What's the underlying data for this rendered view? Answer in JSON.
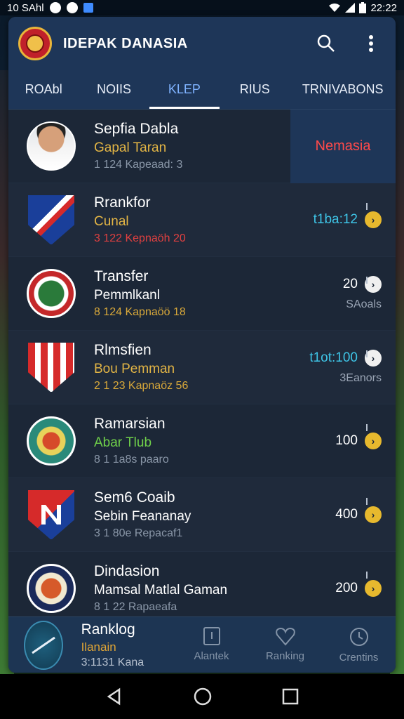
{
  "status_bar": {
    "left_text": "10 SAhl",
    "time": "22:22"
  },
  "header": {
    "title": "IDEPAK DANASIA",
    "search_icon": "search-icon",
    "menu_icon": "more-vert-icon"
  },
  "tabs": [
    {
      "label": "ROAbl"
    },
    {
      "label": "NOIIS"
    },
    {
      "label": "KLEP"
    },
    {
      "label": "RIUS"
    },
    {
      "label": "TRNIVABONS"
    }
  ],
  "rows": [
    {
      "title": "Sepfia Dabla",
      "sub": "Gapal Taran",
      "sub_color": "#e3b545",
      "meta": "1 124 Kapeaad: 3",
      "meta_color": "#8a97a8",
      "badge": "Nemasia"
    },
    {
      "title": "Rrankfor",
      "sub": "Cunal",
      "sub_color": "#e3b545",
      "meta": "3 122 Kepnaöh 20",
      "meta_color": "#e04040",
      "value": "t1ba:12",
      "value_color": "#3ec4e6",
      "right_sub": ""
    },
    {
      "title": "Transfer",
      "sub": "Pemmlkanl",
      "sub_color": "#ffffff",
      "meta": "8 124 Kapnaöö 18",
      "meta_color": "#d8a83a",
      "value": "20",
      "value_color": "#ffffff",
      "right_sub": "SAoals"
    },
    {
      "title": "Rlmsfien",
      "sub": "Bou Pemman",
      "sub_color": "#e3b545",
      "meta": "2 1 23 Kapnaöz 56",
      "meta_color": "#d8a83a",
      "value": "t1ot:100",
      "value_color": "#3ec4e6",
      "right_sub": "3Eanors"
    },
    {
      "title": "Ramarsian",
      "sub": "Abar Tlub",
      "sub_color": "#6fcf4a",
      "meta": "8 1 1a8s paaro",
      "meta_color": "#8a97a8",
      "value": "100",
      "value_color": "#ffffff",
      "right_sub": ""
    },
    {
      "title": "Sem6 Coaib",
      "sub": "Sebin Feananay",
      "sub_color": "#ffffff",
      "meta": "3 1 80e Repacaf1",
      "meta_color": "#8a97a8",
      "value": "400",
      "value_color": "#ffffff",
      "right_sub": ""
    },
    {
      "title": "Dindasion",
      "sub": "Mamsal Matlal Gaman",
      "sub_color": "#ffffff",
      "meta": "8 1 22 Rapaeafa",
      "meta_color": "#8a97a8",
      "value": "200",
      "value_color": "#ffffff",
      "right_sub": ""
    }
  ],
  "bottom_bar": {
    "title": "Ranklog",
    "sub": "Ilanain",
    "meta": "3:1131 Kana",
    "nav": [
      {
        "label": "Alantek",
        "icon": "card-icon"
      },
      {
        "label": "Ranking",
        "icon": "heart-icon"
      },
      {
        "label": "Crentins",
        "icon": "clock-icon"
      }
    ]
  },
  "colors": {
    "header_bg": "#1e3658",
    "accent_gold": "#e7b92e",
    "accent_cyan": "#3ec4e6",
    "badge_red": "#ff4a4a"
  }
}
